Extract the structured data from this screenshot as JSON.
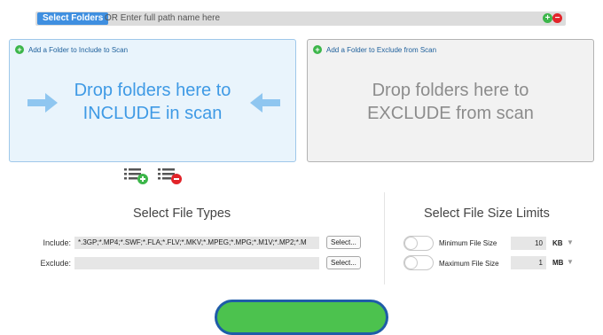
{
  "path_bar": {
    "select_folders_label": "Select Folders",
    "path_placeholder": "OR Enter full path name here",
    "add_icon": "plus-circle-icon",
    "remove_icon": "minus-circle-icon"
  },
  "include_panel": {
    "header": "Add a Folder to Include to Scan",
    "drop_line1": "Drop folders here to",
    "drop_line2": "INCLUDE in scan"
  },
  "exclude_panel": {
    "header": "Add a Folder to Exclude from Scan",
    "drop_line1": "Drop folders here to",
    "drop_line2": "EXCLUDE from scan"
  },
  "file_types": {
    "title": "Select File Types",
    "include_label": "Include:",
    "include_value": "*.3GP;*.MP4;*.SWF;*.FLA;*.FLV;*.MKV;*.MPEG;*.MPG;*.M1V;*.MP2;*.M",
    "exclude_label": "Exclude:",
    "exclude_value": "",
    "select_label": "Select..."
  },
  "size_limits": {
    "title": "Select File Size Limits",
    "min_label": "Minimum File Size",
    "min_value": "10",
    "min_unit": "KB",
    "max_label": "Maximum File Size",
    "max_value": "1",
    "max_unit": "MB",
    "caret": "▼"
  },
  "colors": {
    "accent": "#3f8fe0",
    "include_text": "#3f9ae5",
    "add_green": "#3cb64a",
    "remove_red": "#e2242a",
    "scan_green": "#4cc24e"
  }
}
